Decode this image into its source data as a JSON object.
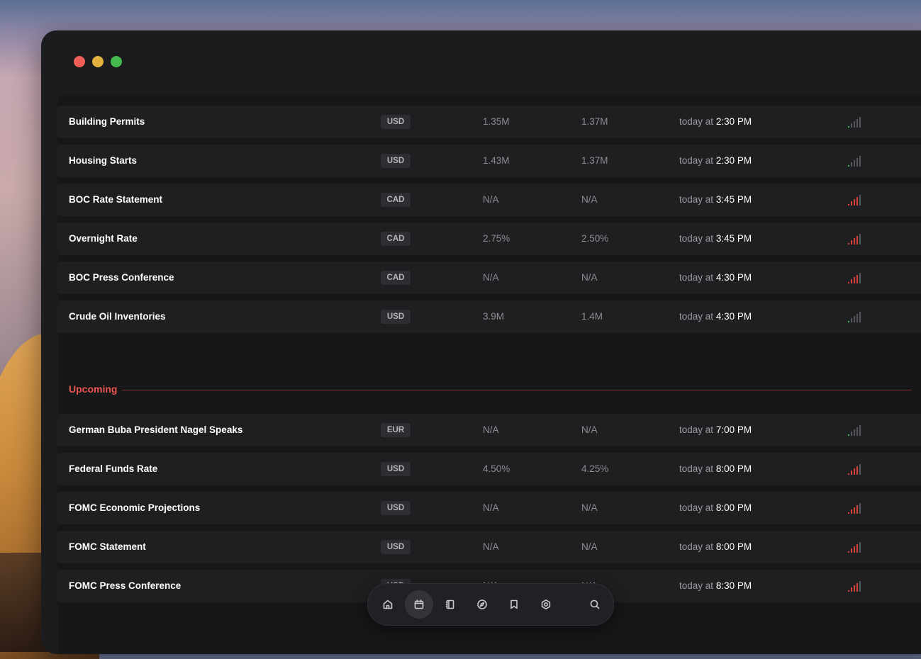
{
  "window": {
    "controls": [
      "close",
      "minimize",
      "zoom"
    ],
    "colors": {
      "close": "#ed5e56",
      "minimize": "#e3b33d",
      "zoom": "#46b94f"
    }
  },
  "past_events": [
    {
      "name": "Building Permits",
      "currency": "USD",
      "actual": "1.35M",
      "forecast": "1.37M",
      "time_prefix": "today at",
      "time": "2:30 PM",
      "impact": "low"
    },
    {
      "name": "Housing Starts",
      "currency": "USD",
      "actual": "1.43M",
      "forecast": "1.37M",
      "time_prefix": "today at",
      "time": "2:30 PM",
      "impact": "low"
    },
    {
      "name": "BOC Rate Statement",
      "currency": "CAD",
      "actual": "N/A",
      "forecast": "N/A",
      "time_prefix": "today at",
      "time": "3:45 PM",
      "impact": "high"
    },
    {
      "name": "Overnight Rate",
      "currency": "CAD",
      "actual": "2.75%",
      "forecast": "2.50%",
      "time_prefix": "today at",
      "time": "3:45 PM",
      "impact": "high"
    },
    {
      "name": "BOC Press Conference",
      "currency": "CAD",
      "actual": "N/A",
      "forecast": "N/A",
      "time_prefix": "today at",
      "time": "4:30 PM",
      "impact": "high"
    },
    {
      "name": "Crude Oil Inventories",
      "currency": "USD",
      "actual": "3.9M",
      "forecast": "1.4M",
      "time_prefix": "today at",
      "time": "4:30 PM",
      "impact": "low"
    }
  ],
  "upcoming": {
    "label": "Upcoming",
    "color": "#e8564f",
    "events": [
      {
        "name": "German Buba President Nagel Speaks",
        "currency": "EUR",
        "actual": "N/A",
        "forecast": "N/A",
        "time_prefix": "today at",
        "time": "7:00 PM",
        "impact": "low"
      },
      {
        "name": "Federal Funds Rate",
        "currency": "USD",
        "actual": "4.50%",
        "forecast": "4.25%",
        "time_prefix": "today at",
        "time": "8:00 PM",
        "impact": "high"
      },
      {
        "name": "FOMC Economic Projections",
        "currency": "USD",
        "actual": "N/A",
        "forecast": "N/A",
        "time_prefix": "today at",
        "time": "8:00 PM",
        "impact": "high"
      },
      {
        "name": "FOMC Statement",
        "currency": "USD",
        "actual": "N/A",
        "forecast": "N/A",
        "time_prefix": "today at",
        "time": "8:00 PM",
        "impact": "high"
      },
      {
        "name": "FOMC Press Conference",
        "currency": "USD",
        "actual": "N/A",
        "forecast": "N/A",
        "time_prefix": "today at",
        "time": "8:30 PM",
        "impact": "high"
      }
    ]
  },
  "impact_colors": {
    "low_active": "#3fae4c",
    "high_active": "#e0403a",
    "inactive": "#55565a"
  },
  "dock": {
    "items": [
      {
        "icon": "home-icon",
        "active": false
      },
      {
        "icon": "calendar-icon",
        "active": true
      },
      {
        "icon": "notebook-icon",
        "active": false
      },
      {
        "icon": "compass-icon",
        "active": false
      },
      {
        "icon": "bookmark-icon",
        "active": false
      },
      {
        "icon": "settings-icon",
        "active": false
      },
      {
        "icon": "search-icon",
        "active": false
      }
    ]
  }
}
